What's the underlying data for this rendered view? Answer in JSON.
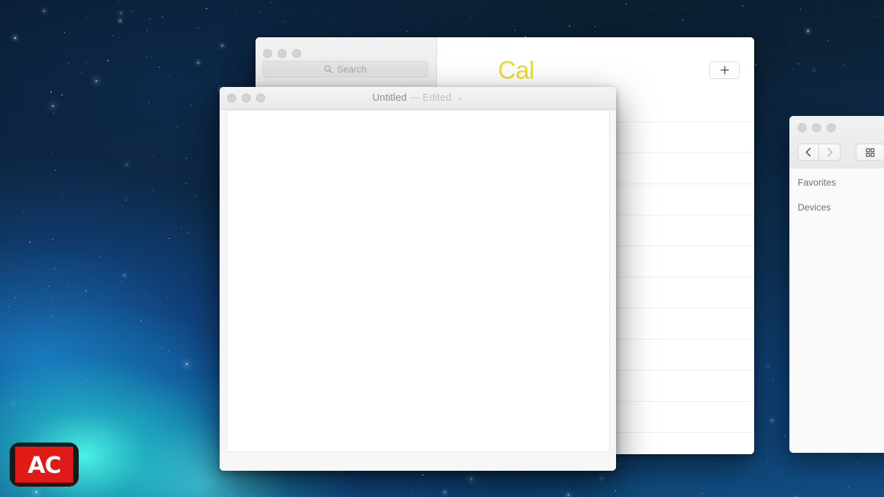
{
  "desktop": {
    "wallpaper_name": "space-nebula-wallpaper",
    "colors": {
      "deep_navy": "#0a1a29",
      "mid_blue": "#0e3358",
      "nebula_cyan": "#50ffeb",
      "nebula_blue": "#1e8ce1"
    }
  },
  "watermark": {
    "text": "AC",
    "badge_color": "#e01b17",
    "frame_color": "#1a1a1a"
  },
  "notes_window": {
    "app": "Notes",
    "search": {
      "placeholder": "Search",
      "value": "",
      "icon": "search-icon"
    },
    "note_title": "Cal",
    "note_title_color": "#e8dd2e",
    "add_button_label": "+",
    "note_rows": [
      {
        "title": "",
        "preview": ""
      },
      {
        "title": "",
        "preview": ""
      },
      {
        "title": "",
        "preview": ""
      },
      {
        "title": "",
        "preview": ""
      },
      {
        "title": "",
        "preview": ""
      },
      {
        "title": "",
        "preview": ""
      },
      {
        "title": "",
        "preview": ""
      },
      {
        "title": "",
        "preview": ""
      },
      {
        "title": "",
        "preview": ""
      },
      {
        "title": "",
        "preview": ""
      },
      {
        "title": "",
        "preview": ""
      },
      {
        "title": "",
        "preview": ""
      }
    ],
    "traffic_lights": [
      "close",
      "minimize",
      "zoom"
    ]
  },
  "textedit_window": {
    "app": "TextEdit",
    "title": "Untitled",
    "separator": "—",
    "status": "Edited",
    "chevron": "⌄",
    "document_text": "",
    "traffic_lights": [
      "close",
      "minimize",
      "zoom"
    ]
  },
  "finder_window": {
    "app": "Finder",
    "toolbar": {
      "back_icon": "chevron-left-icon",
      "forward_icon": "chevron-right-icon",
      "view_icon": "grid-view-icon"
    },
    "sidebar": {
      "sections": [
        {
          "label": "Favorites",
          "items": []
        },
        {
          "label": "Devices",
          "items": []
        }
      ]
    },
    "traffic_lights": [
      "close",
      "minimize",
      "zoom"
    ]
  }
}
